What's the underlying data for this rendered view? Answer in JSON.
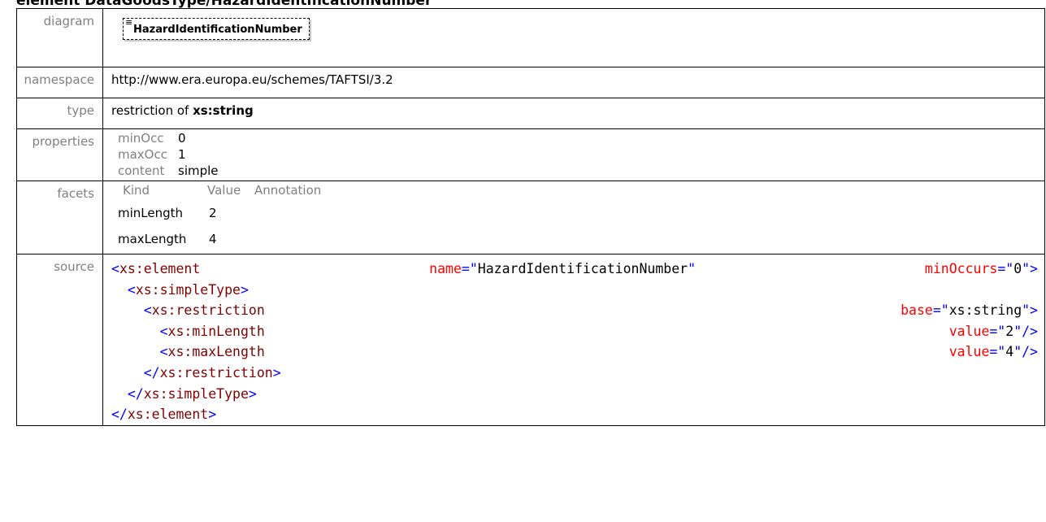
{
  "heading": "element DataGoodsType/HazardIdentificationNumber",
  "rows": {
    "diagram": {
      "label": "diagram",
      "box": "HazardIdentificationNumber"
    },
    "namespace": {
      "label": "namespace",
      "value": "http://www.era.europa.eu/schemes/TAFTSI/3.2"
    },
    "type": {
      "label": "type",
      "prefix": "restriction of ",
      "bold": "xs:string"
    },
    "properties": {
      "label": "properties",
      "items": [
        {
          "key": "minOcc",
          "value": "0"
        },
        {
          "key": "maxOcc",
          "value": "1"
        },
        {
          "key": "content",
          "value": "simple"
        }
      ]
    },
    "facets": {
      "label": "facets",
      "headers": [
        "Kind",
        "Value",
        "Annotation"
      ],
      "items": [
        {
          "kind": "minLength",
          "value": "2"
        },
        {
          "kind": "maxLength",
          "value": "4"
        }
      ]
    },
    "source": {
      "label": "source",
      "tag_element": "xs:element",
      "attr_name": "name",
      "name_val": "HazardIdentificationNumber",
      "attr_minOccurs": "minOccurs",
      "minOccurs_val": "0",
      "tag_simpleType": "xs:simpleType",
      "tag_restriction": "xs:restriction",
      "attr_base": "base",
      "base_val": "xs:string",
      "tag_minLength": "xs:minLength",
      "tag_maxLength": "xs:maxLength",
      "attr_value": "value",
      "minLength_val": "2",
      "maxLength_val": "4"
    }
  }
}
